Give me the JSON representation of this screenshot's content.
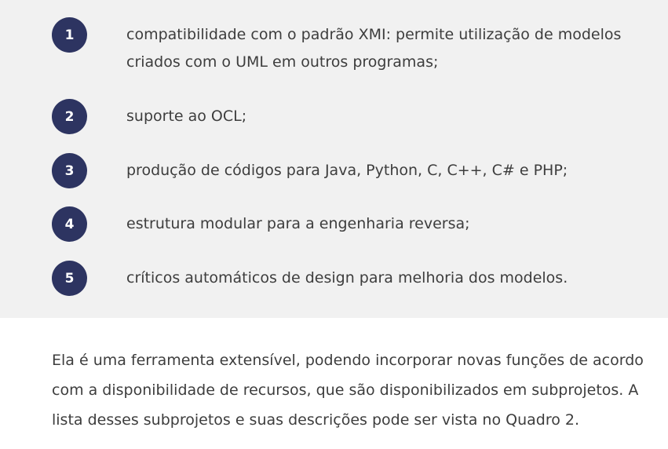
{
  "list": {
    "items": [
      {
        "number": "1",
        "text": "compatibilidade com o padrão XMI: permite utilização de modelos criados com o UML em outros programas;"
      },
      {
        "number": "2",
        "text": "suporte ao OCL;"
      },
      {
        "number": "3",
        "text": "produção de códigos para Java, Python, C, C++, C# e PHP;"
      },
      {
        "number": "4",
        "text": "estrutura modular para a engenharia reversa;"
      },
      {
        "number": "5",
        "text": "críticos automáticos de design para melhoria dos modelos."
      }
    ]
  },
  "paragraph": {
    "text": "Ela é uma ferramenta extensível, podendo incorporar novas funções de acordo com a disponibilidade de recursos, que são disponibilizados em subprojetos. A lista desses subprojetos e suas descrições pode ser vista no Quadro 2."
  },
  "colors": {
    "panel_background": "#f1f1f1",
    "badge_background": "#2d3461",
    "text": "#3d3d3d"
  }
}
